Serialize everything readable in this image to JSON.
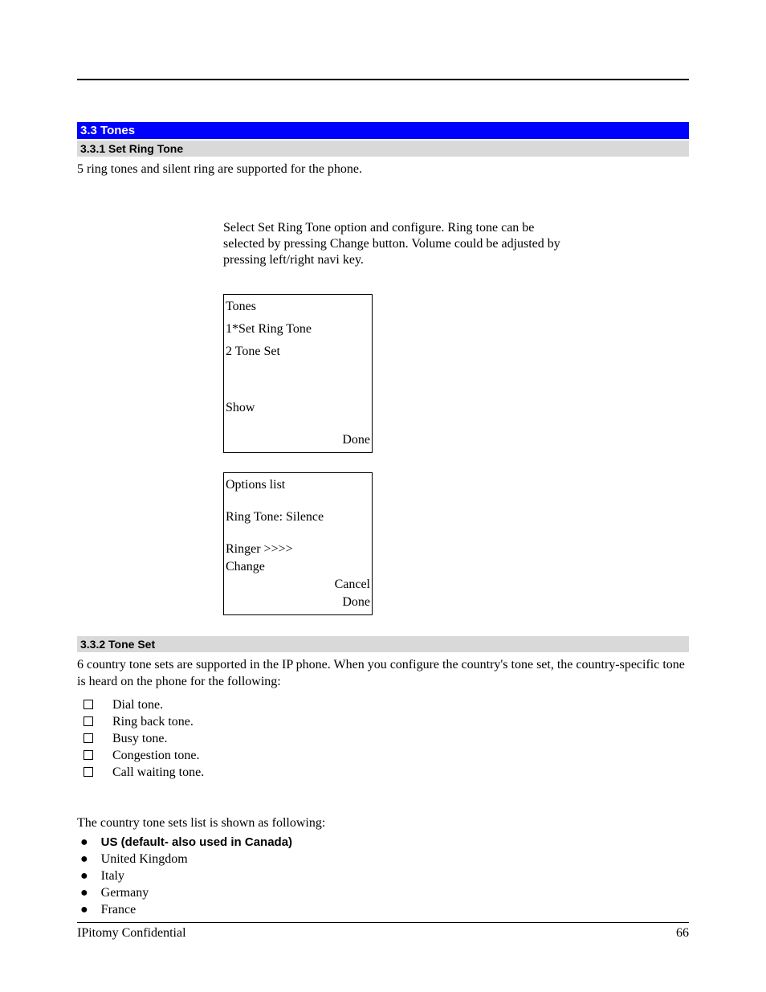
{
  "section": {
    "title": "3.3 Tones"
  },
  "subsection1": {
    "title": "3.3.1 Set Ring Tone",
    "text": "5 ring tones and silent ring are supported for the phone.",
    "instruction": "Select Set Ring Tone option and configure. Ring tone can be selected by pressing Change button. Volume could be adjusted by pressing left/right navi key."
  },
  "screen1": {
    "title": "Tones",
    "item1": "1*Set Ring Tone",
    "item2": "2 Tone Set",
    "softkey1": "Show",
    "softkey2": "Done"
  },
  "screen2": {
    "title": "Options list",
    "line1": "Ring Tone: Silence",
    "line2": "Ringer  >>>>",
    "softkey_change": "Change",
    "softkey_cancel": "Cancel",
    "softkey_done": "Done"
  },
  "subsection2": {
    "title": "3.3.2 Tone Set",
    "text": "6 country tone sets are supported in the IP phone. When you configure the country's tone set, the country-specific tone is heard on the phone for the following:"
  },
  "tone_types": [
    "Dial tone.",
    "Ring back tone.",
    "Busy tone.",
    "Congestion tone.",
    "Call waiting tone."
  ],
  "followup_text": "The country tone sets list is shown as following:",
  "countries": [
    {
      "label": "US (default- also used in Canada)",
      "bold": true
    },
    {
      "label": "United Kingdom",
      "bold": false
    },
    {
      "label": "Italy",
      "bold": false
    },
    {
      "label": "Germany",
      "bold": false
    },
    {
      "label": "France",
      "bold": false
    }
  ],
  "footer": {
    "left": "IPitomy Confidential",
    "right": "66"
  }
}
